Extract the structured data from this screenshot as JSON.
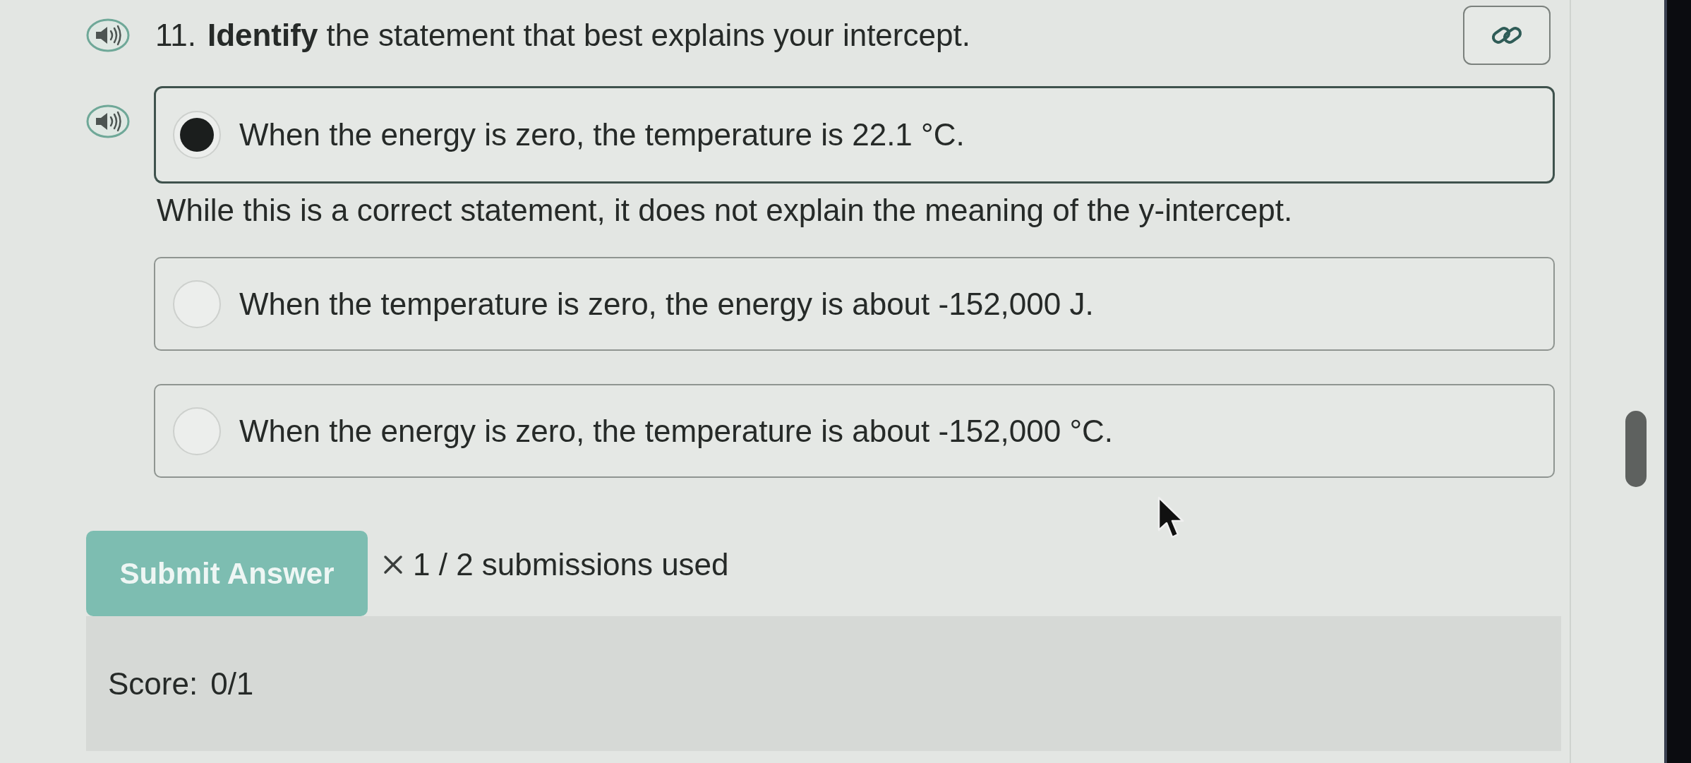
{
  "question": {
    "number": "11.",
    "text": "**Identify** the statement that best explains your intercept."
  },
  "options": [
    {
      "text": "When the energy is zero, the temperature is 22.1 °C.",
      "selected": true,
      "feedback": "While this is a correct statement, it does not explain the meaning of the y-intercept."
    },
    {
      "text": "When the temperature is zero, the energy is about -152,000 J.",
      "selected": false
    },
    {
      "text": "When the energy is zero, the temperature is about -152,000 °C.",
      "selected": false
    }
  ],
  "submit_button": {
    "label": "Submit Answer",
    "disabled": true
  },
  "submissions": {
    "text": "1 / 2 submissions used"
  },
  "score": {
    "label": "Score:",
    "value": "0/1"
  }
}
